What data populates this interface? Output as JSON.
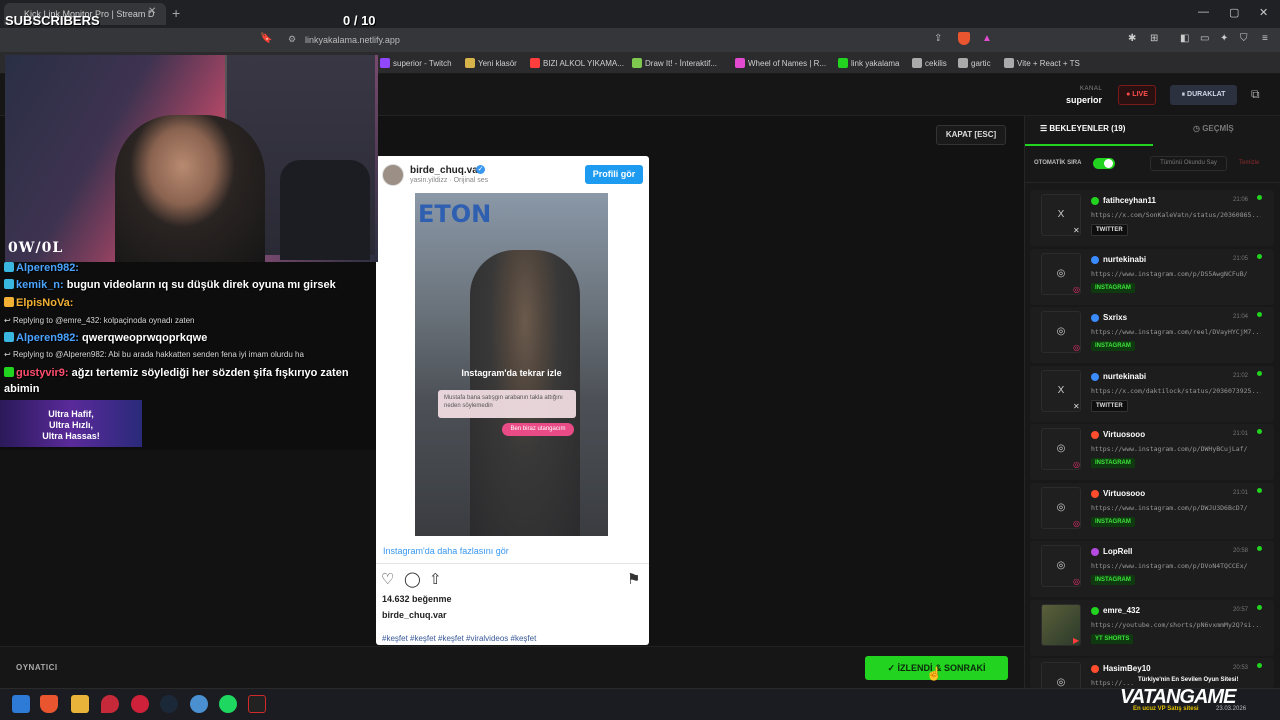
{
  "browser": {
    "tab_title": "Kick Link Monitor Pro | Stream D",
    "url": "linkyakalama.netlify.app",
    "bookmarks": [
      {
        "label": "superior - Twitch",
        "color": "#9146ff"
      },
      {
        "label": "Yeni klasör",
        "color": "#d7b44a"
      },
      {
        "label": "BIZI ALKOL YIKAMA...",
        "color": "#ff3d3d"
      },
      {
        "label": "Draw It! - İnteraktif...",
        "color": "#7ec850"
      },
      {
        "label": "Wheel of Names | R...",
        "color": "#e24ad0"
      },
      {
        "label": "link yakalama",
        "color": "#22d31f"
      },
      {
        "label": "cekilis",
        "color": "#aaaaaa"
      },
      {
        "label": "gartic",
        "color": "#aaaaaa"
      },
      {
        "label": "Vite + React + TS",
        "color": "#aaaaaa"
      }
    ]
  },
  "overlay": {
    "subs_label": "SUBSCRIBERS",
    "subs_count": "0  / 10",
    "webcam_tag": "0W/0L",
    "ad_text_1": "Ultra Hafif,",
    "ad_text_2": "Ultra Hızlı,",
    "ad_text_3": "Ultra Hassas!"
  },
  "chat": [
    {
      "type": "msg",
      "user": "Alperen982:",
      "user_color": "#4aa3ff",
      "text": "",
      "badge": "#3ab7e0"
    },
    {
      "type": "msg",
      "user": "kemik_n:",
      "user_color": "#4aa3ff",
      "text": "bugun videoların ıq su düşük direk oyuna mı girsek",
      "badge": "#3ab7e0"
    },
    {
      "type": "msg",
      "user": "ElpisNoVa:",
      "user_color": "#f2b134",
      "text": "",
      "badge": "#f2b134"
    },
    {
      "type": "reply",
      "text": "Replying to @emre_432: kolpaçinoda oynadı zaten"
    },
    {
      "type": "msg",
      "user": "Alperen982:",
      "user_color": "#4aa3ff",
      "text": "qwerqweoprwqoprkqwe",
      "badge": "#3ab7e0"
    },
    {
      "type": "reply",
      "text": "Replying to @Alperen982: Abi bu arada hakkatten senden fena iyi imam olurdu ha"
    },
    {
      "type": "msg",
      "user": "gustyvir9:",
      "user_color": "#ff4d6d",
      "text": "ağzı tertemiz söylediği her sözden şifa fışkırıyo zaten",
      "badge": "#22d31f"
    },
    {
      "type": "cont",
      "text": "abimin"
    }
  ],
  "header": {
    "kanal_label": "KANAL",
    "kanal_value": "superior",
    "live_label": "● LIVE",
    "pause_label": "⏸ DURAKLAT"
  },
  "player": {
    "close_label": "KAPAT [ESC]",
    "bottom_label": "OYNATICI",
    "next_label": "✓ İZLENDİ & SONRAKİ"
  },
  "instagram": {
    "username": "birde_chuq.var",
    "subline": "yasin.yildizz · Orijinal ses",
    "profile_btn": "Profili gör",
    "video_sign": "ETON",
    "rewatch": "Instagram'da tekrar izle",
    "overlay_msg": "Mustafa bana satışgın arabanın takla attığını neden söylemedin",
    "overlay_reply": "Ben biraz utangacım",
    "more_link": "Instagram'da daha fazlasını gör",
    "likes": "14.632 beğenme",
    "caption_user": "birde_chuq.var",
    "tags": "#keşfet #keşfet #keşfet #viralvideos #keşfet"
  },
  "queue": {
    "tab_waiting": "☰ BEKLEYENLER (19)",
    "tab_history": "◷ GEÇMİŞ",
    "auto_label": "OTOMATİK SIRA",
    "mark_all": "Tümünü Okundu Say",
    "clear": "Temizle",
    "items": [
      {
        "user": "fatihceyhan11",
        "time": "21:06",
        "url": "https://x.com/SonKaleVatn/status/20360865...",
        "platform": "TWITTER",
        "dot": "#22d31f",
        "thumb": "X"
      },
      {
        "user": "nurtekinabi",
        "time": "21:05",
        "url": "https://www.instagram.com/p/DS5AwgNCFuB/",
        "platform": "INSTAGRAM",
        "dot": "#3a8bff",
        "thumb": "◎"
      },
      {
        "user": "Sxrixs",
        "time": "21:04",
        "url": "https://www.instagram.com/reel/DVayHYCjM7...",
        "platform": "INSTAGRAM",
        "dot": "#3a8bff",
        "thumb": "◎"
      },
      {
        "user": "nurtekinabi",
        "time": "21:02",
        "url": "https://x.com/daktilock/status/2036073925...",
        "platform": "TWITTER",
        "dot": "#3a8bff",
        "thumb": "X"
      },
      {
        "user": "Virtuosooo",
        "time": "21:01",
        "url": "https://www.instagram.com/p/DWHyBCujLaf/",
        "platform": "INSTAGRAM",
        "dot": "#ff4d2d",
        "thumb": "◎"
      },
      {
        "user": "Virtuosooo",
        "time": "21:01",
        "url": "https://www.instagram.com/p/DWJU3D6BcD7/",
        "platform": "INSTAGRAM",
        "dot": "#ff4d2d",
        "thumb": "◎"
      },
      {
        "user": "LopRell",
        "time": "20:58",
        "url": "https://www.instagram.com/p/DVoN4TQCCEx/",
        "platform": "INSTAGRAM",
        "dot": "#b44ae0",
        "thumb": "◎"
      },
      {
        "user": "emre_432",
        "time": "20:57",
        "url": "https://youtube.com/shorts/pN6vxmmMy2Q?si...",
        "platform": "YT SHORTS",
        "dot": "#22d31f",
        "thumb": "img"
      },
      {
        "user": "HasimBey10",
        "time": "20:53",
        "url": "https://...",
        "platform": "",
        "dot": "#ff4d2d",
        "thumb": "◎"
      }
    ]
  },
  "watermark": {
    "logo": "VATANGAME",
    "tagline": "Türkiye'nin En Sevilen Oyun Sitesi!",
    "sub": "En ucuz VP Satış sitesi",
    "date": "23.03.2026"
  }
}
